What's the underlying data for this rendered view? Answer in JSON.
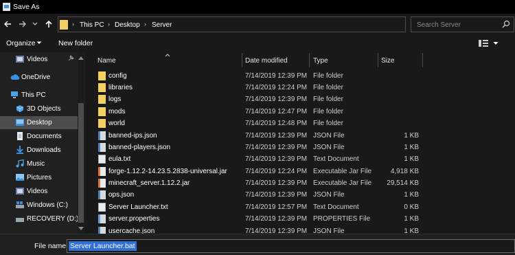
{
  "window": {
    "title": "Save As"
  },
  "address": {
    "crumbs": [
      "This PC",
      "Desktop",
      "Server"
    ],
    "search_placeholder": "Search Server"
  },
  "toolbar": {
    "organize": "Organize",
    "new_folder": "New folder"
  },
  "nav": {
    "items": [
      {
        "label": "Videos",
        "icon": "video-folder-icon",
        "pinned": true
      },
      {
        "label": "OneDrive",
        "icon": "cloud-icon"
      },
      {
        "label": "This PC",
        "icon": "computer-icon"
      },
      {
        "label": "3D Objects",
        "icon": "cube-icon"
      },
      {
        "label": "Desktop",
        "icon": "desktop-folder-icon",
        "selected": true
      },
      {
        "label": "Documents",
        "icon": "document-icon"
      },
      {
        "label": "Downloads",
        "icon": "download-icon"
      },
      {
        "label": "Music",
        "icon": "music-icon"
      },
      {
        "label": "Pictures",
        "icon": "image-icon"
      },
      {
        "label": "Videos",
        "icon": "video-folder-icon"
      },
      {
        "label": "Windows (C:)",
        "icon": "drive-icon"
      },
      {
        "label": "RECOVERY (D:)",
        "icon": "drive-icon"
      }
    ]
  },
  "columns": {
    "name": "Name",
    "date": "Date modified",
    "type": "Type",
    "size": "Size"
  },
  "files": [
    {
      "name": "config",
      "date": "7/14/2019 12:39 PM",
      "type": "File folder",
      "size": "",
      "kind": "folder"
    },
    {
      "name": "libraries",
      "date": "7/14/2019 12:24 PM",
      "type": "File folder",
      "size": "",
      "kind": "folder"
    },
    {
      "name": "logs",
      "date": "7/14/2019 12:39 PM",
      "type": "File folder",
      "size": "",
      "kind": "folder"
    },
    {
      "name": "mods",
      "date": "7/14/2019 12:47 PM",
      "type": "File folder",
      "size": "",
      "kind": "folder"
    },
    {
      "name": "world",
      "date": "7/14/2019 12:48 PM",
      "type": "File folder",
      "size": "",
      "kind": "folder"
    },
    {
      "name": "banned-ips.json",
      "date": "7/14/2019 12:39 PM",
      "type": "JSON File",
      "size": "1 KB",
      "kind": "json"
    },
    {
      "name": "banned-players.json",
      "date": "7/14/2019 12:39 PM",
      "type": "JSON File",
      "size": "1 KB",
      "kind": "json"
    },
    {
      "name": "eula.txt",
      "date": "7/14/2019 12:39 PM",
      "type": "Text Document",
      "size": "1 KB",
      "kind": "txt"
    },
    {
      "name": "forge-1.12.2-14.23.5.2838-universal.jar",
      "date": "7/14/2019 12:24 PM",
      "type": "Executable Jar File",
      "size": "4,918 KB",
      "kind": "jar"
    },
    {
      "name": "minecraft_server.1.12.2.jar",
      "date": "7/14/2019 12:39 PM",
      "type": "Executable Jar File",
      "size": "29,514 KB",
      "kind": "jar"
    },
    {
      "name": "ops.json",
      "date": "7/14/2019 12:39 PM",
      "type": "JSON File",
      "size": "1 KB",
      "kind": "json"
    },
    {
      "name": "Server Launcher.txt",
      "date": "7/14/2019 12:57 PM",
      "type": "Text Document",
      "size": "0 KB",
      "kind": "txt"
    },
    {
      "name": "server.properties",
      "date": "7/14/2019 12:39 PM",
      "type": "PROPERTIES File",
      "size": "1 KB",
      "kind": "prop"
    },
    {
      "name": "usercache.json",
      "date": "7/14/2019 12:39 PM",
      "type": "JSON File",
      "size": "1 KB",
      "kind": "json"
    }
  ],
  "filename": {
    "label": "File name:",
    "value": "Server Launcher.bat"
  }
}
